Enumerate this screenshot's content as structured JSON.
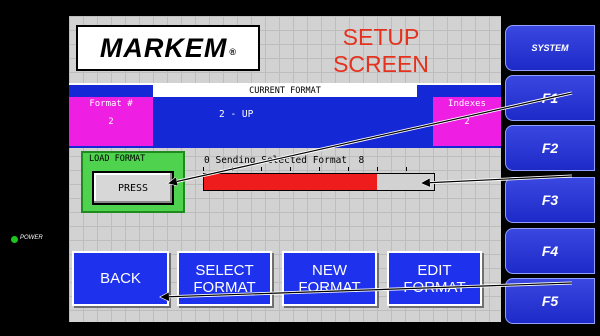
{
  "power": {
    "label": "POWER",
    "color": "#1ec51e"
  },
  "logo": {
    "text": "MARKEM",
    "reg": "®"
  },
  "title": {
    "line1": "SETUP",
    "line2": "SCREEN",
    "color": "#e4321e"
  },
  "current_format": {
    "header": "CURRENT FORMAT",
    "format_label": "Format #",
    "format_value": "2",
    "value": "2 - UP",
    "indexes_label": "Indexes",
    "indexes_value": "2"
  },
  "load_format": {
    "label": "LOAD FORMAT",
    "button": "PRESS"
  },
  "progress": {
    "caption_start": "0",
    "caption": "Sending Selected Format",
    "caption_end": "8",
    "value_fraction": 0.75,
    "fill_color": "#ee1c1c"
  },
  "buttons": {
    "back": "BACK",
    "select": [
      "SELECT",
      "FORMAT"
    ],
    "new": [
      "NEW",
      "FORMAT"
    ],
    "edit": [
      "EDIT",
      "FORMAT"
    ]
  },
  "function_keys": [
    "SYSTEM",
    "F1",
    "F2",
    "F3",
    "F4",
    "F5"
  ],
  "colors": {
    "panel_blue": "#1428d6",
    "magenta": "#ee1ee2",
    "button_blue": "#1e32ee"
  }
}
